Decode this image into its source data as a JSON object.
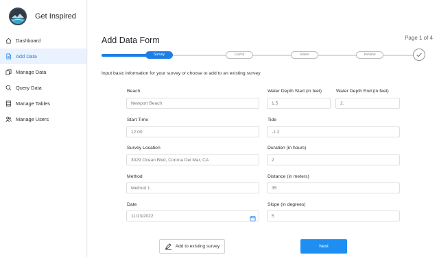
{
  "app": {
    "brand_name": "Get Inspired"
  },
  "sidebar": {
    "items": [
      {
        "label": "Dashboard",
        "icon": "home-icon",
        "active": false
      },
      {
        "label": "Add Data",
        "icon": "file-icon",
        "active": true
      },
      {
        "label": "Manage Data",
        "icon": "copy-icon",
        "active": false
      },
      {
        "label": "Query Data",
        "icon": "search-icon",
        "active": false
      },
      {
        "label": "Manage Tables",
        "icon": "table-icon",
        "active": false
      },
      {
        "label": "Manage Users",
        "icon": "users-icon",
        "active": false
      }
    ]
  },
  "header": {
    "title": "Add Data Form",
    "page_count": "Page 1 of 4"
  },
  "stepper": {
    "steps": [
      "Survey",
      "Clams",
      "Raker",
      "Review"
    ],
    "active_index": 0
  },
  "form": {
    "intro": "Input basic information for your survey or choose to add to an existing survey",
    "beach": {
      "label": "Beach",
      "placeholder": "Newport Beach"
    },
    "water_depth_start": {
      "label": "Water Depth Start (in feet)",
      "placeholder": "1.5"
    },
    "water_depth_end": {
      "label": "Water Depth End (in feet)",
      "placeholder": "2."
    },
    "start_time": {
      "label": "Start Time",
      "placeholder": "12:00"
    },
    "tide": {
      "label": "Tide",
      "placeholder": "-1.2"
    },
    "survey_location": {
      "label": "Survey Location",
      "placeholder": "3029 Ocean Blvd, Corona Del Mar, CA"
    },
    "duration": {
      "label": "Duration (in hours)",
      "placeholder": "2"
    },
    "method": {
      "label": "Method",
      "placeholder": "Method 1"
    },
    "distance": {
      "label": "Distance (in meters)",
      "placeholder": "35"
    },
    "date": {
      "label": "Date",
      "placeholder": "11/13/2022"
    },
    "slope": {
      "label": "Slope (in degrees)",
      "placeholder": "5"
    }
  },
  "actions": {
    "add_existing_label": "Add to existing survey",
    "next_label": "Next"
  },
  "colors": {
    "accent": "#1e7ee6",
    "active_nav_bg": "#e9f2fe",
    "next_button": "#1e8ef0"
  }
}
